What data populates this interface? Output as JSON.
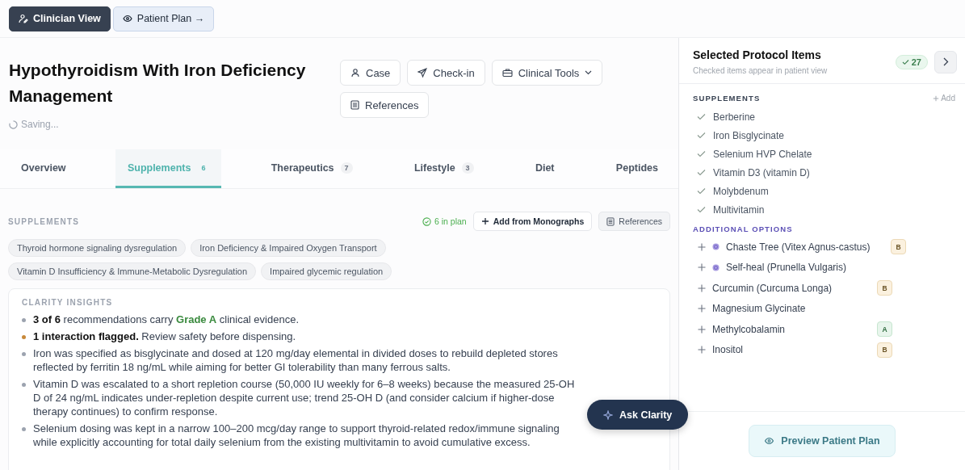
{
  "view_switch": [
    {
      "label": "Clinician View",
      "selected": true
    },
    {
      "label": "Patient Plan →",
      "selected": false
    }
  ],
  "case": {
    "title": "Hypothyroidism With Iron Deficiency Management",
    "status": "Saving..."
  },
  "actions": [
    {
      "kind": "case",
      "label": "Case"
    },
    {
      "kind": "checkin",
      "label": "Check-in"
    },
    {
      "kind": "tools",
      "label": "Clinical Tools"
    },
    {
      "kind": "references",
      "label": "References"
    }
  ],
  "tabs": [
    {
      "label": "Overview",
      "selected": false
    },
    {
      "label": "Supplements",
      "count": "6",
      "selected": true
    },
    {
      "label": "Therapeutics",
      "count": "7",
      "selected": false
    },
    {
      "label": "Lifestyle",
      "count": "3",
      "selected": false
    },
    {
      "label": "Diet",
      "selected": false
    },
    {
      "label": "Peptides",
      "selected": false
    }
  ],
  "section": {
    "heading": "SUPPLEMENTS",
    "in_plan": "6 in plan",
    "add_button": "Add from Monographs",
    "references_button": "References"
  },
  "tags": [
    "Thyroid hormone signaling dysregulation",
    "Iron Deficiency & Impaired Oxygen Transport",
    "Vitamin D Insufficiency & Immune-Metabolic Dysregulation",
    "Impaired glycemic regulation"
  ],
  "insights": {
    "heading": "CLARITY INSIGHTS",
    "items": [
      {
        "color": "#9ca3af",
        "text": "**3 of 6** recommendations carry *Grade A* clinical evidence."
      },
      {
        "color": "#c8893a",
        "text": "**1 interaction flagged.** Review safety before dispensing."
      },
      {
        "color": "#9ca3af",
        "text": "Iron was specified as bisglycinate and dosed at 120 mg/day elemental in divided doses to rebuild depleted stores reflected by ferritin 18 ng/mL while aiming for better GI tolerability than many ferrous salts."
      },
      {
        "color": "#9ca3af",
        "text": "Vitamin D was escalated to a short repletion course (50,000 IU weekly for 6–8 weeks) because the measured 25-OH D of 24 ng/mL indicates under-repletion despite current use; trend 25-OH D (and consider calcium if higher-dose therapy continues) to confirm response."
      },
      {
        "color": "#9ca3af",
        "text": "Selenium dosing was kept in a narrow 100–200 mcg/day range to support thyroid-related redox/immune signaling while explicitly accounting for total daily selenium from the existing multivitamin to avoid cumulative excess."
      }
    ]
  },
  "ask_button": "Ask Clarity",
  "panel": {
    "title": "Selected Protocol Items",
    "subtitle": "Checked items appear in patient view",
    "count": "27",
    "supplements_heading": "SUPPLEMENTS",
    "add_label": "Add",
    "selected": [
      "Berberine",
      "Iron Bisglycinate",
      "Selenium HVP Chelate",
      "Vitamin D3 (vitamin D)",
      "Molybdenum",
      "Multivitamin"
    ],
    "options_heading": "ADDITIONAL OPTIONS",
    "options": [
      {
        "name": "Chaste Tree (Vitex Agnus-castus)",
        "herbal": true,
        "grade": "B"
      },
      {
        "name": "Self-heal (Prunella Vulgaris)",
        "herbal": true
      },
      {
        "name": "Curcumin (Curcuma Longa)",
        "herbal": false,
        "grade": "B"
      },
      {
        "name": "Magnesium Glycinate",
        "herbal": false
      },
      {
        "name": "Methylcobalamin",
        "herbal": false,
        "grade": "A"
      },
      {
        "name": "Inositol",
        "herbal": false,
        "grade": "B"
      }
    ],
    "preview_button": "Preview Patient Plan"
  }
}
